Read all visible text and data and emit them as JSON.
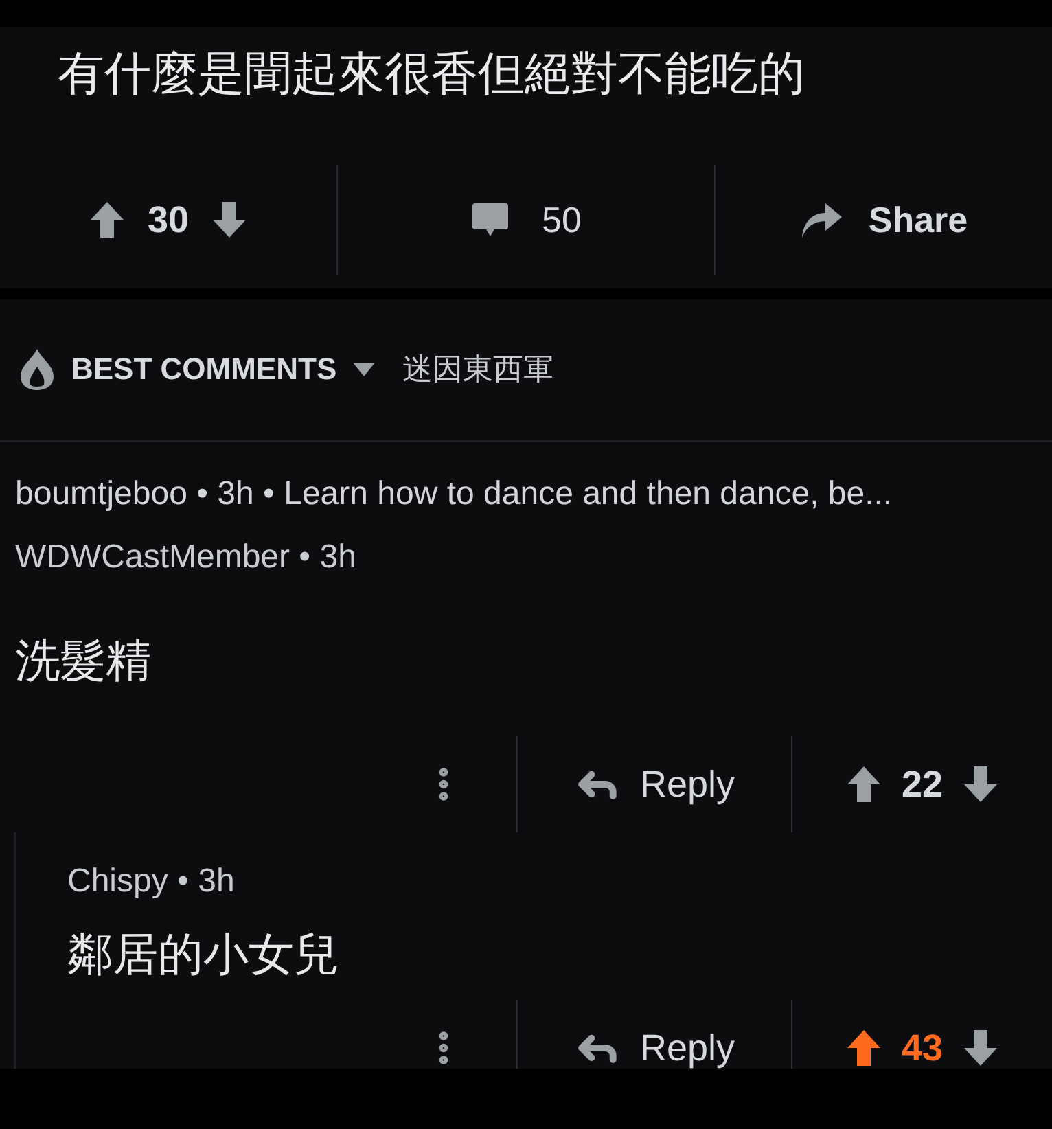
{
  "post": {
    "title": "有什麼是聞起來很香但絕對不能吃的",
    "score": "30",
    "upvoted": false,
    "comments": "50",
    "share": "Share"
  },
  "sort": {
    "label": "BEST COMMENTS",
    "community": "迷因東西軍"
  },
  "comments": [
    {
      "kind": "collapsed",
      "meta": "boumtjeboo • 3h • Learn how to dance and then dance, be..."
    },
    {
      "kind": "full",
      "meta": "WDWCastMember • 3h",
      "body": "洗髮精",
      "reply": "Reply",
      "score": "22",
      "upvoted": false,
      "children": [
        {
          "kind": "full",
          "meta": "Chispy • 3h",
          "body": "鄰居的小女兒",
          "reply": "Reply",
          "score": "43",
          "upvoted": true
        }
      ]
    }
  ]
}
